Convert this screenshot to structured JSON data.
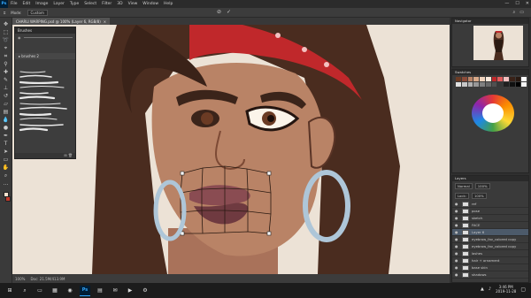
{
  "app": {
    "logo_text": "Ps",
    "menu": [
      "File",
      "Edit",
      "Image",
      "Layer",
      "Type",
      "Select",
      "Filter",
      "3D",
      "View",
      "Window",
      "Help"
    ],
    "window_controls": [
      "—",
      "☐",
      "✕"
    ]
  },
  "options_bar": {
    "mode_label": "Mode:",
    "mode_value": "Custom"
  },
  "document_tab": {
    "title": "CHARLI WARPING.psd @ 100% (Layer 6, RGB/8)",
    "close": "×"
  },
  "brushes_panel": {
    "title": "Brushes",
    "folder_label": "brushes 2",
    "stroke_count": 12
  },
  "status_bar": {
    "zoom": "100%",
    "doc_info": "Doc: 21.5M/413.9M"
  },
  "panels": {
    "navigator_title": "Navigator",
    "swatches_title": "Swatches",
    "layers_title": "Layers",
    "layers_mode": "Normal",
    "layers_opacity": "100%",
    "layers_lock": "Lock:",
    "layers_fill": "100%",
    "layers": [
      {
        "name": "ref",
        "selected": false
      },
      {
        "name": "pose",
        "selected": false
      },
      {
        "name": "sketch",
        "selected": false
      },
      {
        "name": "FACE",
        "selected": false
      },
      {
        "name": "Layer 6",
        "selected": true
      },
      {
        "name": "eyebrow_fav_colored copy",
        "selected": false
      },
      {
        "name": "eyebrow_fav_colored copy",
        "selected": false
      },
      {
        "name": "lashes",
        "selected": false
      },
      {
        "name": "hair + ornament",
        "selected": false
      },
      {
        "name": "base skin",
        "selected": false
      },
      {
        "name": "shadows",
        "selected": false
      }
    ]
  },
  "taskbar": {
    "time": "3:46 PM",
    "date": "2019-11-28",
    "icons": [
      "windows-icon",
      "search-icon",
      "taskview-icon",
      "explorer-icon",
      "chrome-icon",
      "photoshop-icon",
      "folder-icon",
      "mail-icon",
      "media-icon",
      "settings-icon"
    ]
  },
  "colors": {
    "ps_dark": "#001e36",
    "ps_blue": "#31a8ff",
    "hair": "#4a2c1f",
    "skin": "#b98366",
    "bandana": "#c0282b",
    "hoop": "#aec6d8"
  }
}
